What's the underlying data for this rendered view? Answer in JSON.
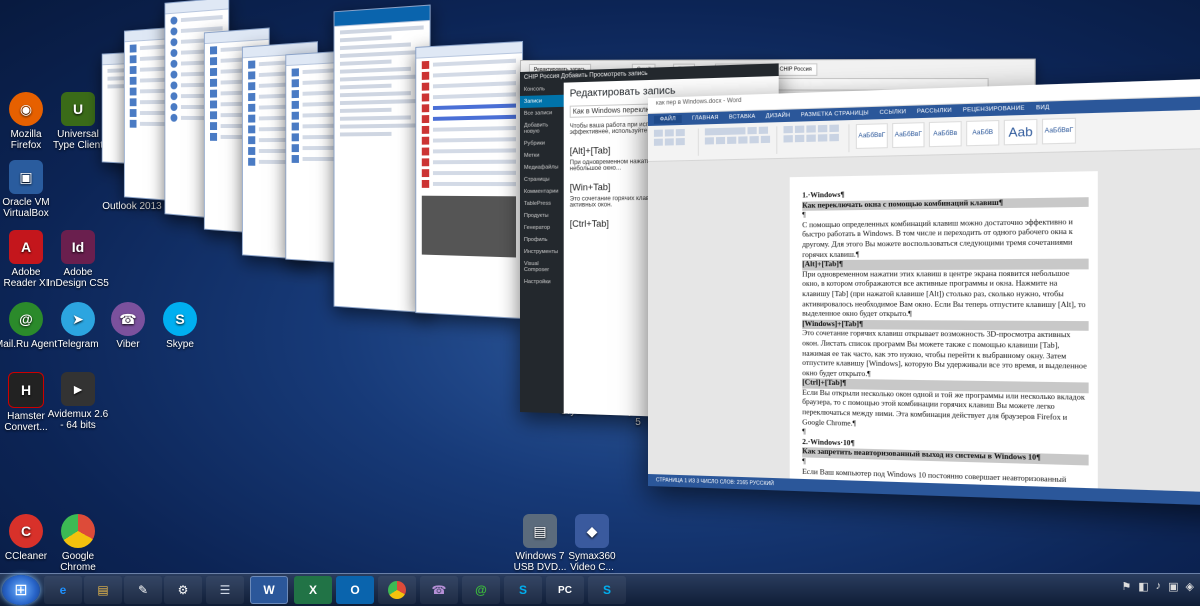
{
  "desktop_icons": [
    {
      "id": "firefox",
      "label": "Mozilla Firefox",
      "symbol": "◉",
      "color": "#e66000"
    },
    {
      "id": "utc",
      "label": "Universal Type Client",
      "symbol": "U",
      "color": "#3a6b18"
    },
    {
      "id": "vbox",
      "label": "Oracle VM VirtualBox",
      "symbol": "▣",
      "color": "#2a5c9e"
    },
    {
      "id": "outlook",
      "label": "Outlook 2013",
      "symbol": "O",
      "color": "#0a64ad"
    },
    {
      "id": "reader",
      "label": "Adobe Reader XI",
      "symbol": "A",
      "color": "#c4161c"
    },
    {
      "id": "indesign",
      "label": "Adobe InDesign CS5",
      "symbol": "Id",
      "color": "#6a1f4e"
    },
    {
      "id": "mailru",
      "label": "Mail.Ru Agent",
      "symbol": "@",
      "color": "#2b8a2b"
    },
    {
      "id": "telegram",
      "label": "Telegram",
      "symbol": "➤",
      "color": "#2ca5e0"
    },
    {
      "id": "viber",
      "label": "Viber",
      "symbol": "☎",
      "color": "#7b519d"
    },
    {
      "id": "skype",
      "label": "Skype",
      "symbol": "S",
      "color": "#00aff0"
    },
    {
      "id": "hamster",
      "label": "Hamster Convert...",
      "symbol": "H",
      "color": "#222"
    },
    {
      "id": "avidemux",
      "label": "Avidemux 2.6 - 64 bits",
      "symbol": "►",
      "color": "#333"
    },
    {
      "id": "ccleaner",
      "label": "CCleaner",
      "symbol": "C",
      "color": "#d8312a"
    },
    {
      "id": "chrome",
      "label": "Google Chrome",
      "symbol": "●",
      "color": "#dd4b39"
    },
    {
      "id": "usbdvd",
      "label": "Windows 7 USB DVD...",
      "symbol": "▤",
      "color": "#5b6b7c"
    },
    {
      "id": "symax",
      "label": "Symax360 Video C...",
      "symbol": "◆",
      "color": "#3a5a9e"
    }
  ],
  "window_titles": {
    "crystal": "CrystalDiskI...",
    "crystal2": "CrystalDiskI... 5"
  },
  "word": {
    "titlebar": "как пер в Windows.docx - Word",
    "tabs": [
      "ФАЙЛ",
      "ГЛАВНАЯ",
      "ВСТАВКА",
      "ДИЗАЙН",
      "РАЗМЕТКА СТРАНИЦЫ",
      "ССЫЛКИ",
      "РАССЫЛКИ",
      "РЕЦЕНЗИРОВАНИЕ",
      "ВИД"
    ],
    "styles": [
      "АаБбВвГ",
      "АаБбВвГ",
      "АаБбВв",
      "АаБбВ",
      "Ааb",
      "АаБбВвГ"
    ],
    "lines": [
      {
        "t": "1.·Windows¶",
        "c": "h"
      },
      {
        "t": "Как переключать окна с помощью комбинаций клавиш¶",
        "c": "hl"
      },
      {
        "t": "¶",
        "c": ""
      },
      {
        "t": "С помощью определенных комбинаций клавиш можно достаточно эффективно и быстро работать в Windows. В том числе и переходить от одного рабочего окна к другому. Для этого Вы можете воспользоваться следующими тремя сочетаниями горячих клавиш.¶",
        "c": ""
      },
      {
        "t": "[Alt]+[Tab]¶",
        "c": "hl"
      },
      {
        "t": "При одновременном нажатии этих клавиш в центре экрана появится небольшое окно, в котором отображаются все активные программы и окна. Нажмите на клавишу [Tab] (при нажатой клавише [Alt]) столько раз, сколько нужно, чтобы активировалось необходимое Вам окно. Если Вы теперь отпустите клавишу [Alt], то выделенное окно будет открыто.¶",
        "c": ""
      },
      {
        "t": "[Windows]+[Tab]¶",
        "c": "hl"
      },
      {
        "t": "Это сочетание горячих клавиш открывает возможность 3D-просмотра активных окон. Листать список программ Вы можете также с помощью клавиши [Tab], нажимая ее так часто, как это нужно, чтобы перейти к выбранному окну. Затем отпустите клавишу [Windows], которую Вы удерживали все это время, и выделенное окно будет открыто.¶",
        "c": ""
      },
      {
        "t": "[Ctrl]+[Tab]¶",
        "c": "hl"
      },
      {
        "t": "Если Вы открыли несколько окон одной и той же программы или несколько вкладок браузера, то с помощью этой комбинации горячих клавиш Вы можете легко переключаться между ними. Эта комбинация действует для браузеров Firefox и Google Chrome.¶",
        "c": ""
      },
      {
        "t": "¶",
        "c": ""
      },
      {
        "t": "2.·Windows·10¶",
        "c": "h"
      },
      {
        "t": "Как запретить неавторизованный выход из системы в Windows 10¶",
        "c": "hl"
      },
      {
        "t": "¶",
        "c": ""
      },
      {
        "t": "Если Ваш компьютер под Windows 10 постоянно совершает неавторизованный выход из",
        "c": ""
      }
    ],
    "status": "СТРАНИЦА 1 ИЗ 3    ЧИСЛО СЛОВ: 2165    РУССКИЙ"
  },
  "wp": {
    "adminbar": "CHIP Россия    Добавить    Просмотреть запись",
    "menu": [
      "Консоль",
      "Записи",
      "Все записи",
      "Добавить новую",
      "Рубрики",
      "Метки",
      "Медиафайлы",
      "Страницы",
      "Комментарии",
      "TablePress",
      "Продукты",
      "Генератор",
      "Профиль",
      "Инструменты",
      "Visual Composer",
      "Настройки"
    ],
    "active_item": "Записи",
    "title": "Редактировать запись",
    "post_title": "Как в Windows переключаться между окнами",
    "intro": "Чтобы ваша работа при использовании Windows стала еще эффективнее, используйте эти горячие клавиши...",
    "h1": "[Alt]+[Tab]",
    "p1": "При одновременном нажатии этих клавиш в центре экрана появится небольшое окно...",
    "h2": "[Win+Tab]",
    "p2": "Это сочетание горячих клавиш открывает возможность 3D-просмотра активных окон.",
    "h3": "[Ctrl+Tab]"
  },
  "browser": {
    "tabs": [
      "Редактировать запись",
      "Gmail",
      "Tabs",
      "Редактировать запись - CHIP Россия"
    ],
    "url": "https://ichip.ru/wp-admin/post.php?post=..."
  },
  "taskbar": [
    {
      "id": "ie",
      "symbol": "e",
      "color": "#1e90ff"
    },
    {
      "id": "explorer",
      "symbol": "▤",
      "color": "#e8b84a"
    },
    {
      "id": "paint",
      "symbol": "✎",
      "color": "#ccc"
    },
    {
      "id": "tool",
      "symbol": "⚙",
      "color": "#bbb"
    },
    {
      "id": "notepad",
      "symbol": "☰",
      "color": "#cfd8e6"
    },
    {
      "id": "word",
      "symbol": "W",
      "color": "#2b579a",
      "active": true
    },
    {
      "id": "excel",
      "symbol": "X",
      "color": "#217346"
    },
    {
      "id": "outlook",
      "symbol": "O",
      "color": "#0a64ad"
    },
    {
      "id": "chrome",
      "symbol": "●",
      "color": "#dd4b39"
    },
    {
      "id": "viber",
      "symbol": "☎",
      "color": "#7b519d"
    },
    {
      "id": "mailru",
      "symbol": "@",
      "color": "#2b8a2b"
    },
    {
      "id": "skype",
      "symbol": "S",
      "color": "#00aff0"
    },
    {
      "id": "pc",
      "symbol": "PC",
      "color": "#5b6b7c"
    },
    {
      "id": "skype2",
      "symbol": "S",
      "color": "#00aff0"
    }
  ]
}
